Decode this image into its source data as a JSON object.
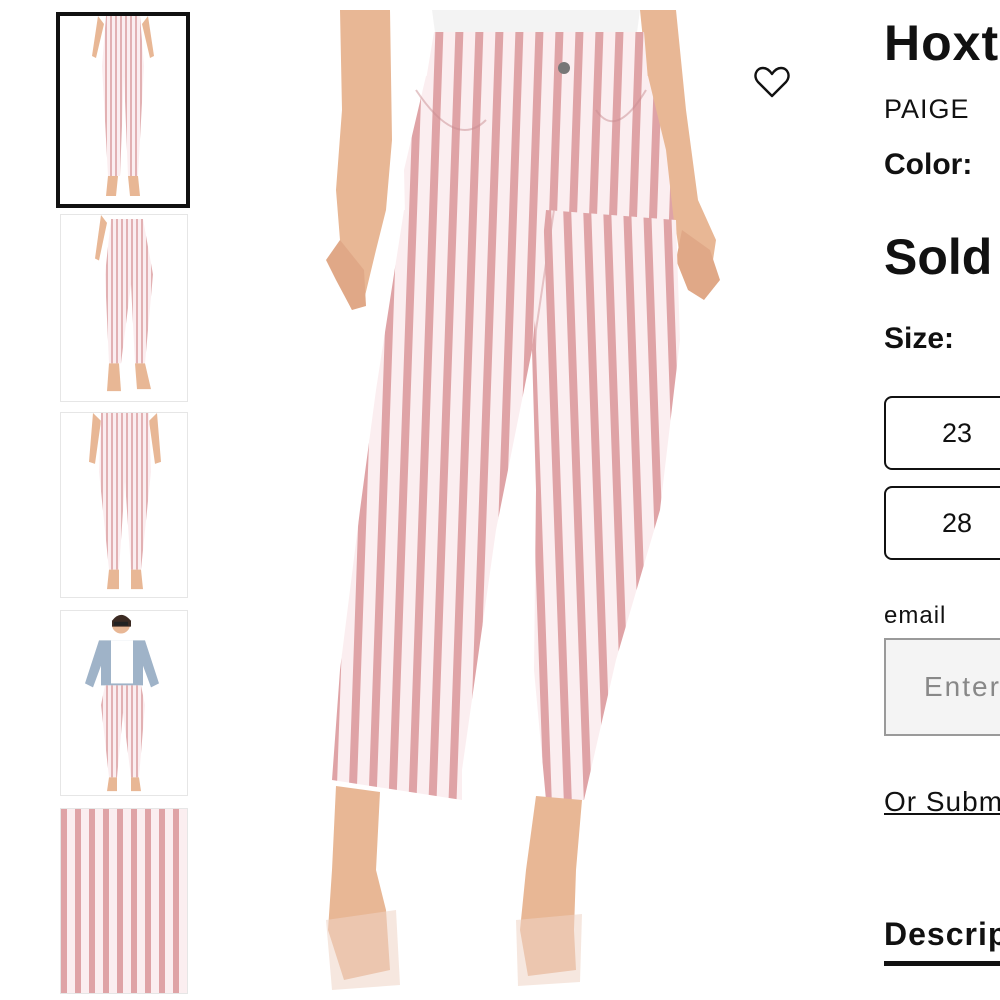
{
  "product": {
    "title": "Hoxt",
    "brand": "PAIGE",
    "color_label": "Color:",
    "price": "Sold",
    "size_label": "Size:",
    "sizes": [
      "23",
      "28"
    ],
    "email_label": "email",
    "email_placeholder": "Enter",
    "submit_link": "Or Subm",
    "description_tab": "Descrip"
  },
  "gallery": {
    "thumbnails": [
      {
        "view": "front",
        "selected": true
      },
      {
        "view": "side",
        "selected": false
      },
      {
        "view": "back",
        "selected": false
      },
      {
        "view": "outfit",
        "selected": false
      },
      {
        "view": "fabric-detail",
        "selected": false
      }
    ]
  },
  "icons": {
    "wishlist": "heart-outline-icon"
  },
  "colors": {
    "stripe_pink": "#dfa3a6",
    "fabric_base": "#fbeef0",
    "skin": "#e8b795",
    "text": "#111111",
    "input_bg": "#f4f4f4"
  }
}
